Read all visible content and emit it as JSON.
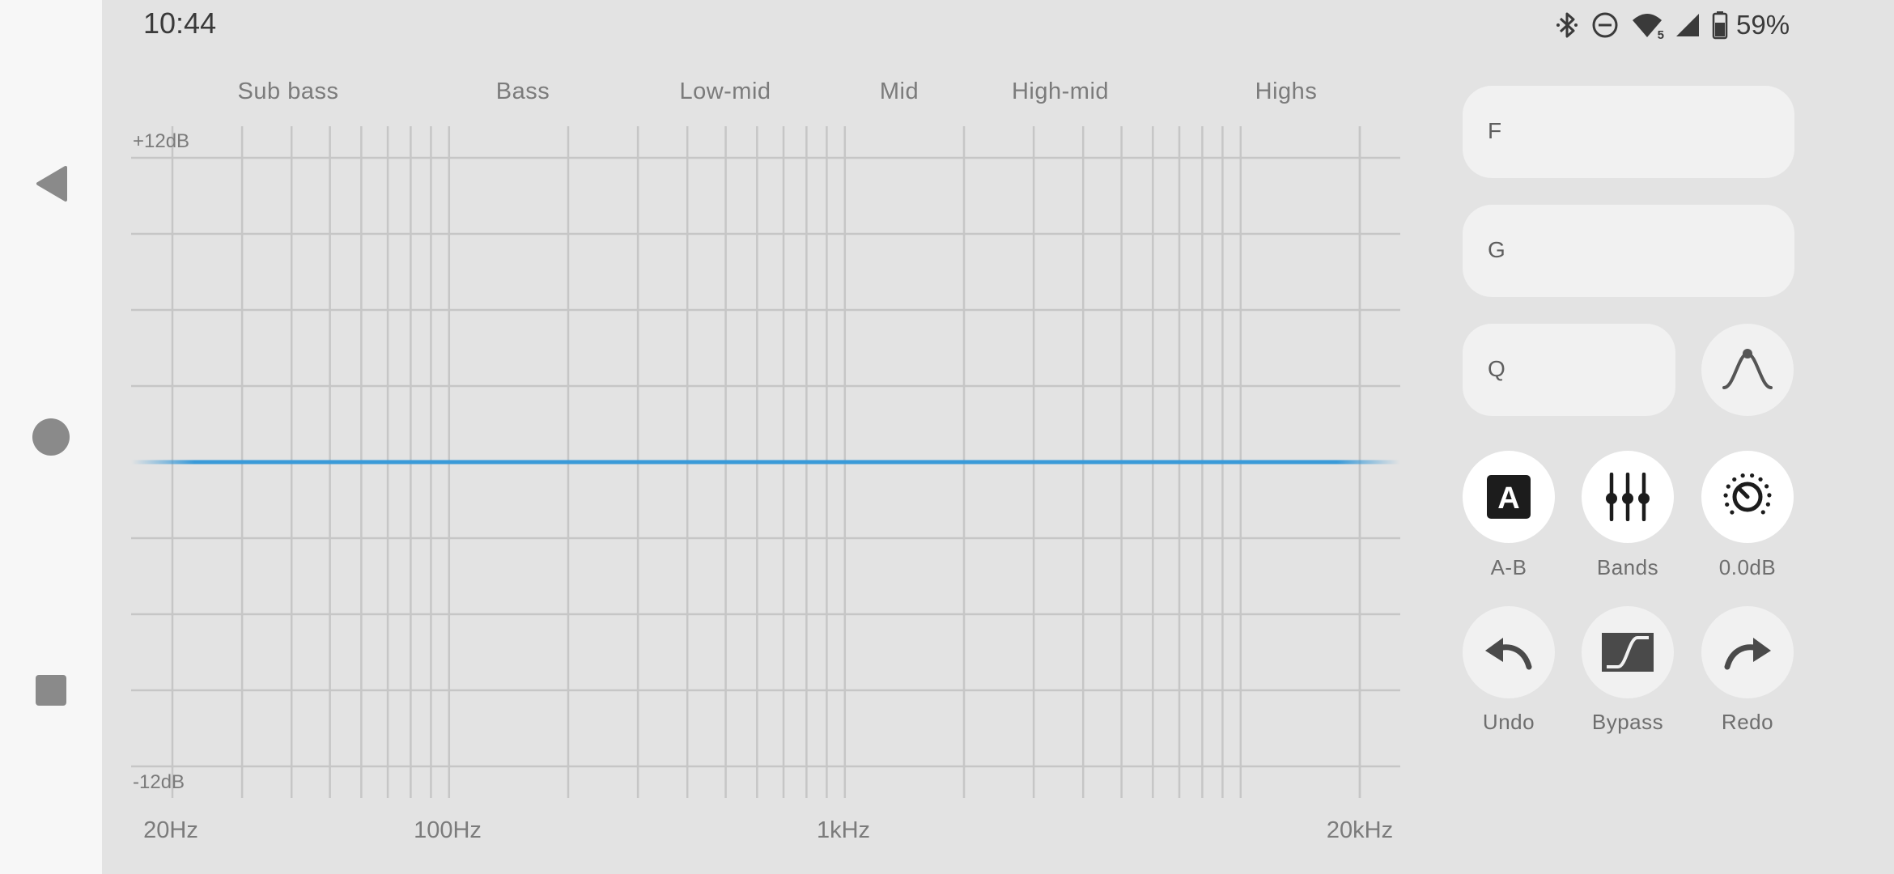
{
  "status_bar": {
    "time": "10:44",
    "battery_percent": "59%",
    "icons": [
      "bluetooth-icon",
      "do-not-disturb-icon",
      "wifi-icon",
      "cell-signal-icon",
      "battery-icon"
    ],
    "wifi_badge": "5"
  },
  "navigation": {
    "back": "back-triangle-icon",
    "home": "home-circle-icon",
    "recents": "recents-square-icon"
  },
  "eq": {
    "bands": [
      "Sub bass",
      "Bass",
      "Low-mid",
      "Mid",
      "High-mid",
      "Highs"
    ],
    "db_top": "+12dB",
    "db_bottom": "-12dB",
    "freq_labels": [
      "20Hz",
      "100Hz",
      "1kHz",
      "20kHz"
    ],
    "gain_db": 0,
    "freq_min_hz": 20,
    "freq_max_hz": 20000,
    "db_range": [
      -12,
      12
    ],
    "curve_color": "#3a9ad8",
    "grid_color": "#c6c6c6"
  },
  "controls": {
    "freq_field_label": "F",
    "freq_field_value": "",
    "gain_field_label": "G",
    "gain_field_value": "",
    "q_field_label": "Q",
    "q_field_value": "",
    "filter_type_icon": "peak-filter-icon",
    "ab_label": "A-B",
    "ab_icon_letter": "A",
    "bands_label": "Bands",
    "gain_label": "0.0dB",
    "undo_label": "Undo",
    "bypass_label": "Bypass",
    "redo_label": "Redo"
  }
}
